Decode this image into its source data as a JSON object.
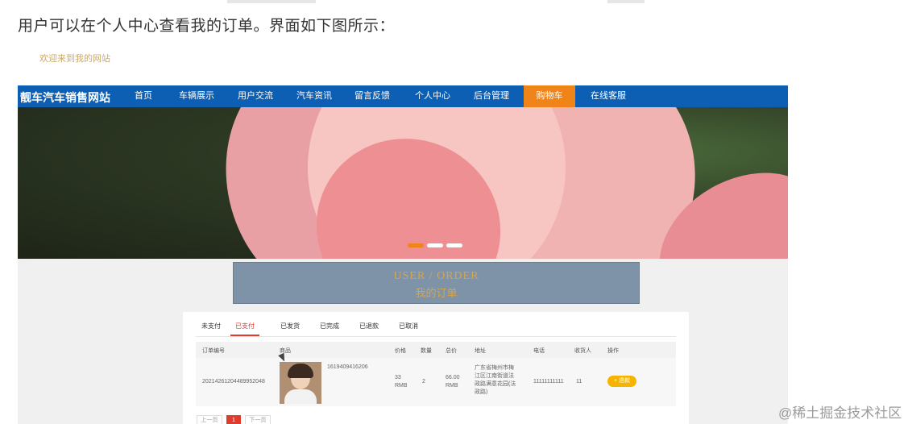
{
  "intro_text": "用户可以在个人中心查看我的订单。界面如下图所示：",
  "welcome_text": "欢迎来到我的网站",
  "site": {
    "logo": "靓车汽车销售网站",
    "nav": [
      "首页",
      "车辆展示",
      "用户交流",
      "汽车资讯",
      "留言反馈",
      "个人中心",
      "后台管理",
      "购物车",
      "在线客服"
    ],
    "active_nav": "购物车",
    "accent_color": "#f08419",
    "nav_color": "#0d5fb4"
  },
  "banner": {
    "slide_count": 3,
    "active_slide": 1
  },
  "order_section": {
    "title_en": "USER / ORDER",
    "title_zh": "我的订单"
  },
  "tabs": [
    "未支付",
    "已支付",
    "已发货",
    "已完成",
    "已退款",
    "已取消"
  ],
  "active_tab": "已支付",
  "table": {
    "headers": [
      "订单编号",
      "商品",
      "价格",
      "数量",
      "总价",
      "地址",
      "电话",
      "收货人",
      "操作"
    ],
    "rows": [
      {
        "order_no": "20214261204489952048",
        "product_code": "1619409416206",
        "price_value": "33",
        "price_unit": "RMB",
        "quantity": "2",
        "total_value": "66.00",
        "total_unit": "RMB",
        "address": "广东省梅州市梅江区江南街道法政路满意花园(法政路)",
        "phone": "11111111111",
        "receiver": "11",
        "action_label": "+ 退款"
      }
    ]
  },
  "pagination": {
    "prev": "上一页",
    "current": "1",
    "next": "下一页"
  },
  "watermark": "@稀土掘金技术社区"
}
